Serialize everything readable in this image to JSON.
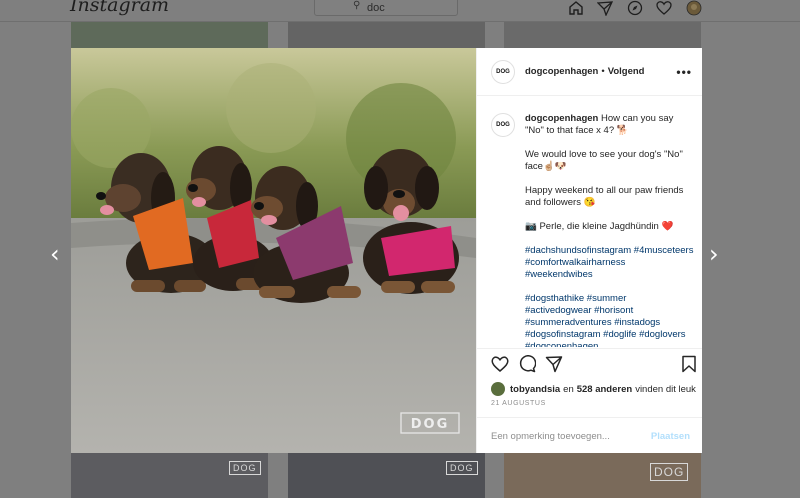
{
  "app": {
    "logo_text": "Instagram"
  },
  "search": {
    "value": "doc",
    "icon": "search-icon"
  },
  "nav": {
    "icons": [
      "home-icon",
      "direct-icon",
      "explore-icon",
      "activity-heart-icon",
      "profile-avatar"
    ]
  },
  "background_brand": "DOG",
  "post": {
    "header": {
      "avatar_text": "DOG",
      "username": "dogcopenhagen",
      "separator": "•",
      "follow_label": "Volgend",
      "more_label": "•••"
    },
    "caption": {
      "username": "dogcopenhagen",
      "line1": "How can you say \"No\" to that face x 4? 🐕",
      "line2": "We would love to see your dog's \"No\" face☝🏼🐶",
      "line3": "Happy weekend to all our paw friends and followers 😘",
      "line4": "📷 Perle, die kleine Jagdhündin ❤️",
      "hashtags1": "#dachshundsofinstagram #4musceteers #comfortwalkairharness #weekendwibes",
      "hashtags2": "#dogsthathike #summer #activedogwear #horisont #summeradventures #instadogs #dogsofinstagram #doglife #doglovers #dogcopenhagen"
    },
    "likes": {
      "user": "tobyandsia",
      "connector": "en",
      "count": "528 anderen",
      "suffix": "vinden dit leuk"
    },
    "date": "21 AUGUSTUS",
    "comment": {
      "placeholder": "Een opmerking toevoegen...",
      "post_label": "Plaatsen"
    },
    "watermark": "DOG"
  },
  "arrows": {
    "prev": "‹",
    "next": "›"
  },
  "colors": {
    "link": "#00376b",
    "post_disabled": "#b2dffc",
    "overlay": "#7f7f7f"
  }
}
